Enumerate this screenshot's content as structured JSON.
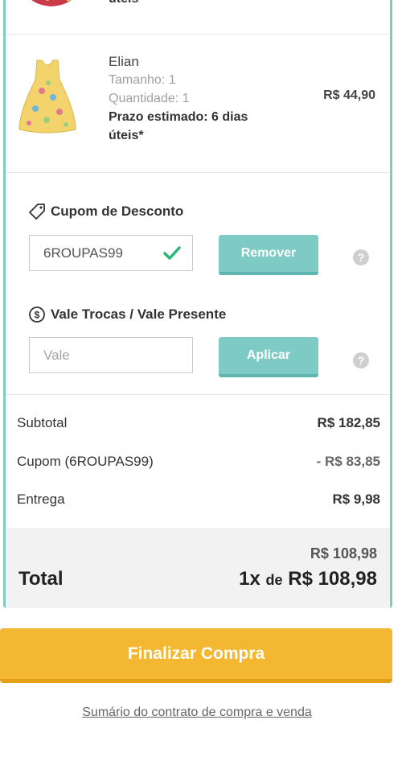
{
  "products": [
    {
      "partial_text": "úteis*"
    },
    {
      "name": "Elian",
      "size": "Tamanho: 1",
      "quantity": "Quantidade: 1",
      "deadline": "Prazo estimado: 6 dias úteis*",
      "price": "R$ 44,90"
    }
  ],
  "coupon": {
    "title": "Cupom de Desconto",
    "value": "6ROUPAS99",
    "button": "Remover",
    "help": "?"
  },
  "voucher": {
    "title": "Vale Trocas / Vale Presente",
    "placeholder": "Vale",
    "button": "Aplicar",
    "help": "?"
  },
  "summary": {
    "subtotal_label": "Subtotal",
    "subtotal_value": "R$ 182,85",
    "coupon_label": "Cupom (6ROUPAS99)",
    "coupon_value": "- R$ 83,85",
    "delivery_label": "Entrega",
    "delivery_value": "R$ 9,98"
  },
  "total": {
    "old_value": "R$ 108,98",
    "label": "Total",
    "installments": "1x",
    "de": "de",
    "value": "R$ 108,98"
  },
  "finalize_button": "Finalizar Compra",
  "contract_link": "Sumário do contrato de compra e venda",
  "colors": {
    "teal": "#7ecbc6",
    "orange": "#f4b731",
    "check_green": "#2bb673"
  }
}
